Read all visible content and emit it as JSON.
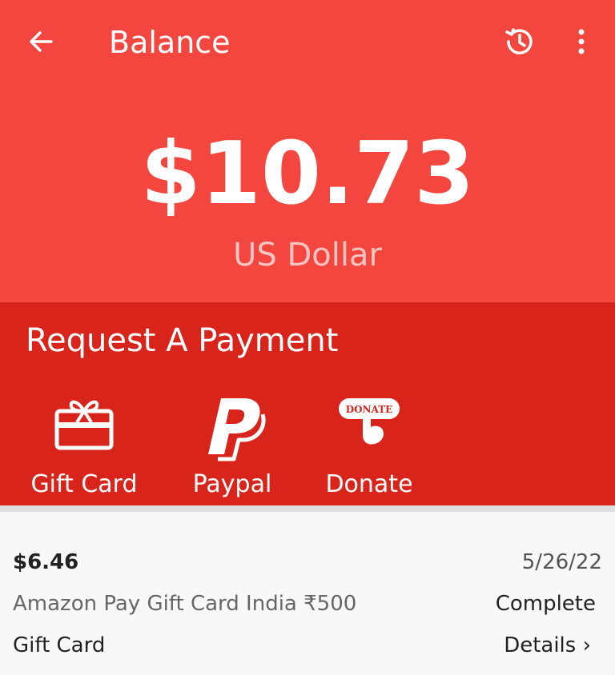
{
  "appbar": {
    "title": "Balance",
    "back_icon": "arrow-left-icon",
    "history_icon": "history-icon",
    "more_icon": "more-vertical-icon"
  },
  "balance": {
    "amount": "$10.73",
    "currency": "US Dollar"
  },
  "request": {
    "title": "Request A Payment",
    "options": [
      {
        "label": "Gift Card",
        "icon": "gift-card-icon"
      },
      {
        "label": "Paypal",
        "icon": "paypal-icon"
      },
      {
        "label": "Donate",
        "icon": "donate-icon",
        "icon_text": "DONATE"
      }
    ]
  },
  "transaction": {
    "amount": "$6.46",
    "date": "5/26/22",
    "description": "Amazon Pay Gift Card India ₹500",
    "status": "Complete",
    "type": "Gift Card",
    "details_label": "Details ›"
  },
  "colors": {
    "header_red": "#f3463f",
    "request_red": "#d9241b",
    "background": "#f8f8f8"
  }
}
